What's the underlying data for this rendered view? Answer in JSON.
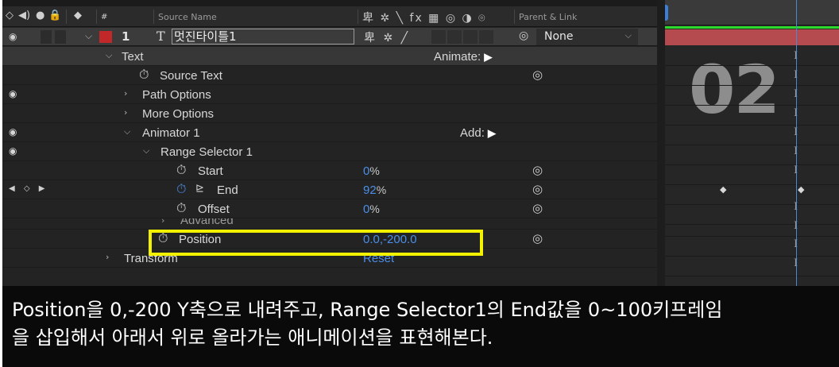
{
  "header": {
    "source_name_label": "Source Name",
    "parent_label": "Parent & Link",
    "switch_icons": "卑 ✲ ╲ fx ▦ ◎ ◑ ⌾"
  },
  "layer": {
    "index": "1",
    "type_glyph": "T",
    "name": "멋진타이틀1",
    "switches": "卑 ✲ ╱",
    "parent_value": "None",
    "color": "#c0282a"
  },
  "properties": {
    "text": "Text",
    "animate_label": "Animate:",
    "source_text": "Source Text",
    "path_options": "Path Options",
    "more_options": "More Options",
    "animator": "Animator 1",
    "add_label": "Add:",
    "range_selector": "Range Selector 1",
    "start": {
      "label": "Start",
      "value": "0",
      "unit": "%"
    },
    "end": {
      "label": "End",
      "value": "92",
      "unit": "%"
    },
    "offset": {
      "label": "Offset",
      "value": "0",
      "unit": "%"
    },
    "advanced": "Advanced",
    "position": {
      "label": "Position",
      "value": "0.0,-200.0"
    },
    "transform": "Transform",
    "reset": "Reset"
  },
  "timeline": {
    "big_text": "02"
  },
  "caption": {
    "line1": "Position을 0,-200 Y축으로 내려주고, Range Selector1의 End값을 0~100키프레임",
    "line2": "을 삽입해서 아래서 위로 올라가는 애니메이션을 표현해본다."
  },
  "colors": {
    "accent_blue": "#4b8ee8",
    "highlight": "#f2f200",
    "layer_bar": "#b54b4e"
  }
}
